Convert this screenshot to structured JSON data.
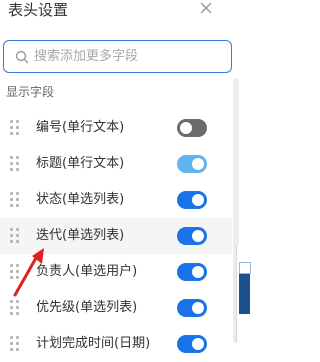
{
  "header": {
    "title": "表头设置"
  },
  "search": {
    "placeholder": "搜索添加更多字段"
  },
  "section": {
    "label": "显示字段"
  },
  "rows": [
    {
      "label": "编号(单行文本)",
      "on": false,
      "color": "#6b6b6b"
    },
    {
      "label": "标题(单行文本)",
      "on": true,
      "color": "#63b3f0"
    },
    {
      "label": "状态(单选列表)",
      "on": true,
      "color": "#1a73e8"
    },
    {
      "label": "迭代(单选列表)",
      "on": true,
      "color": "#1a73e8"
    },
    {
      "label": "负责人(单选用户)",
      "on": true,
      "color": "#1a73e8"
    },
    {
      "label": "优先级(单选列表)",
      "on": true,
      "color": "#1a73e8"
    },
    {
      "label": "计划完成时间(日期)",
      "on": true,
      "color": "#1a73e8"
    }
  ],
  "colors": {
    "accent": "#1a73e8",
    "arrow": "#e02020"
  }
}
